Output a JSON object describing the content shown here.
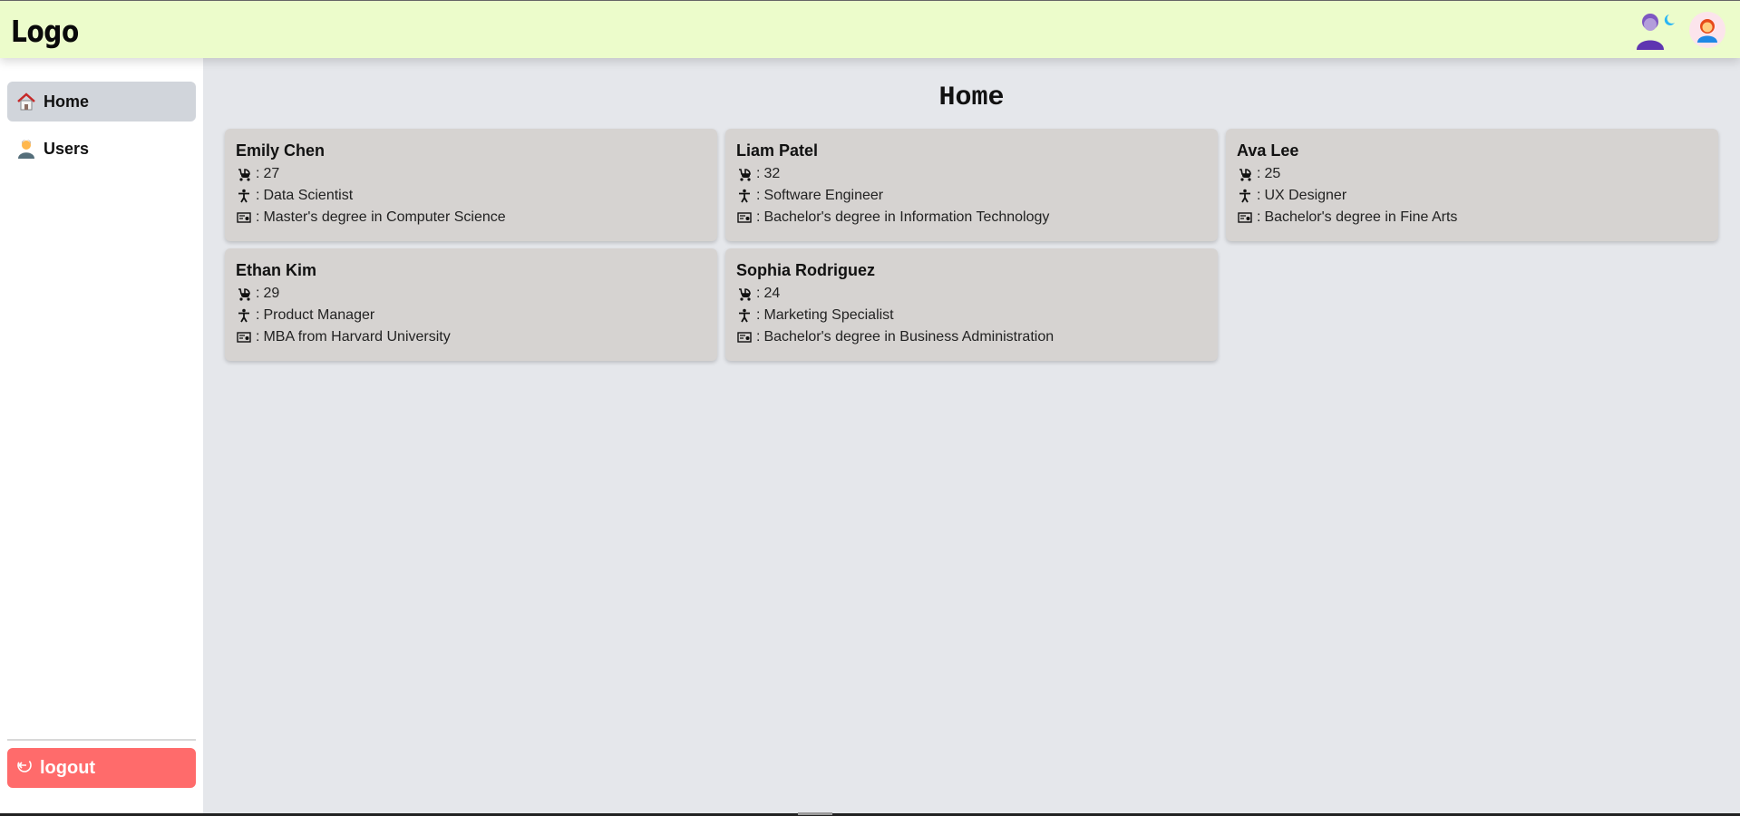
{
  "header": {
    "logo": "Logo"
  },
  "sidebar": {
    "items": [
      {
        "label": "Home",
        "icon": "house-icon"
      },
      {
        "label": "Users",
        "icon": "person-icon"
      }
    ],
    "logout_label": "logout"
  },
  "main": {
    "title": "Home",
    "users": [
      {
        "name": "Emily Chen",
        "age": "27",
        "job": "Data Scientist",
        "education": "Master's degree in Computer Science"
      },
      {
        "name": "Liam Patel",
        "age": "32",
        "job": "Software Engineer",
        "education": "Bachelor's degree in Information Technology"
      },
      {
        "name": "Ava Lee",
        "age": "25",
        "job": "UX Designer",
        "education": "Bachelor's degree in Fine Arts"
      },
      {
        "name": "Ethan Kim",
        "age": "29",
        "job": "Product Manager",
        "education": "MBA from Harvard University"
      },
      {
        "name": "Sophia Rodriguez",
        "age": "24",
        "job": "Marketing Specialist",
        "education": "Bachelor's degree in Business Administration"
      }
    ],
    "separator": ":"
  },
  "colors": {
    "header_bg": "#ecfccb",
    "main_bg": "#e5e7eb",
    "card_bg": "#d6d3d1",
    "active_nav_bg": "#d1d5db",
    "logout_bg": "#ff6b6b"
  }
}
